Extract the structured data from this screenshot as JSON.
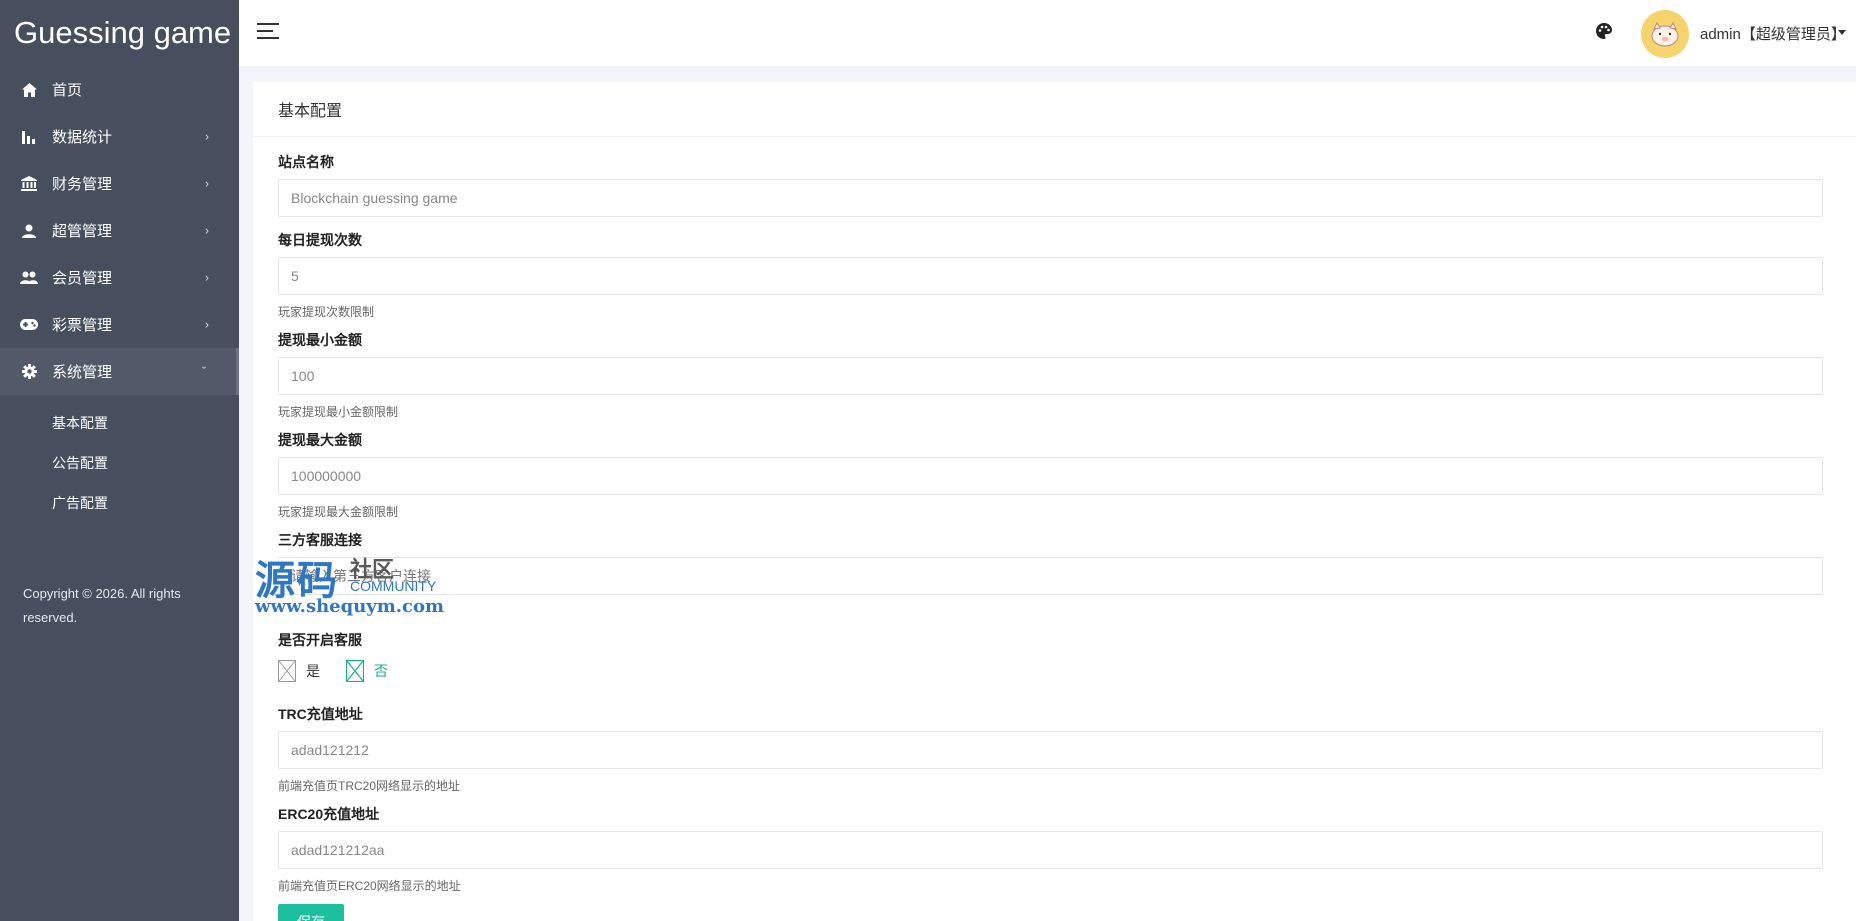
{
  "brand": "Guessing game",
  "sidebar": {
    "items": [
      {
        "label": "首页",
        "icon": "home-icon",
        "arrow": ""
      },
      {
        "label": "数据统计",
        "icon": "bar-chart-icon",
        "arrow": "›"
      },
      {
        "label": "财务管理",
        "icon": "bank-icon",
        "arrow": "›"
      },
      {
        "label": "超管管理",
        "icon": "user-icon",
        "arrow": "›"
      },
      {
        "label": "会员管理",
        "icon": "users-icon",
        "arrow": "›"
      },
      {
        "label": "彩票管理",
        "icon": "gamepad-icon",
        "arrow": "›"
      },
      {
        "label": "系统管理",
        "icon": "gear-icon",
        "arrow": "ˇ"
      }
    ],
    "submenu": [
      "基本配置",
      "公告配置",
      "广告配置"
    ],
    "copyright": "Copyright © 2026. All rights reserved."
  },
  "header": {
    "user": "admin【超级管理员】"
  },
  "card": {
    "title": "基本配置",
    "fields": {
      "site_name": {
        "label": "站点名称",
        "value": "Blockchain guessing game"
      },
      "daily_withdraw": {
        "label": "每日提现次数",
        "value": "5",
        "help": "玩家提现次数限制"
      },
      "min_withdraw": {
        "label": "提现最小金额",
        "value": "100",
        "help": "玩家提现最小金额限制"
      },
      "max_withdraw": {
        "label": "提现最大金额",
        "value": "100000000",
        "help": "玩家提现最大金额限制"
      },
      "service_link": {
        "label": "三方客服连接",
        "placeholder": "请输入第三方客户连接"
      },
      "service_enabled": {
        "label": "是否开启客服",
        "options": [
          "是",
          "否"
        ],
        "selected": "否"
      },
      "trc_address": {
        "label": "TRC充值地址",
        "value": "adad121212",
        "help": "前端充值页TRC20网络显示的地址"
      },
      "erc_address": {
        "label": "ERC20充值地址",
        "value": "adad121212aa",
        "help": "前端充值页ERC20网络显示的地址"
      }
    },
    "save_label": "保存"
  },
  "watermark": {
    "big": "源码",
    "small": "社区",
    "community": "COMMUNITY",
    "url": "www.shequym.com"
  },
  "colors": {
    "sidebar_bg": "#474f5f",
    "accent": "#1dbf9e",
    "avatar_bg": "#f7d36b"
  }
}
